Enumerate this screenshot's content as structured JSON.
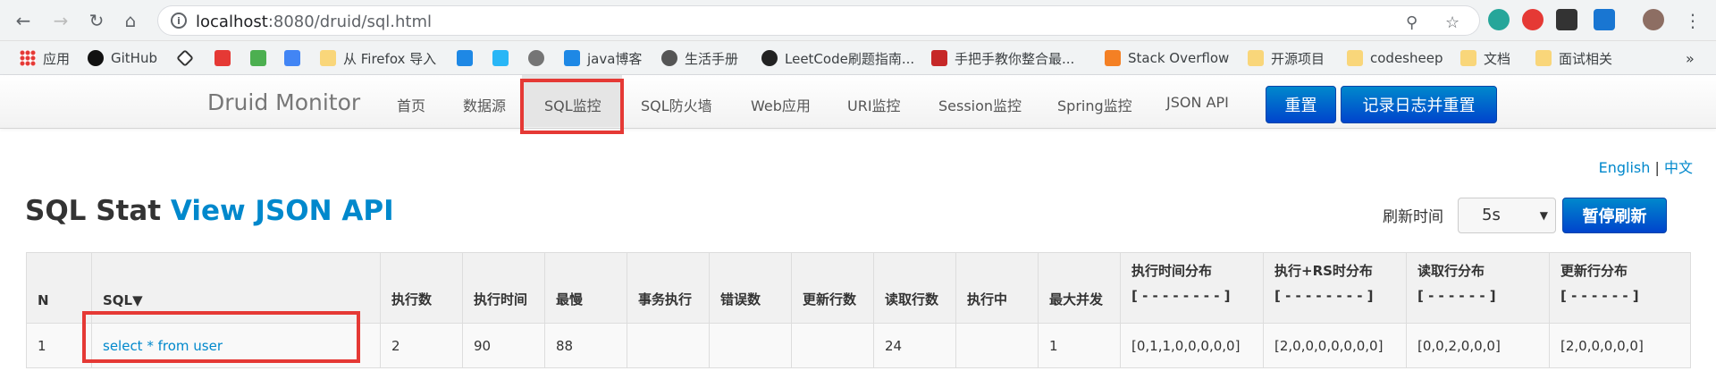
{
  "browser": {
    "url_host": "localhost",
    "url_path": ":8080/druid/sql.html",
    "bookmarks": [
      {
        "label": "应用",
        "icon": "apps-grid-icon"
      },
      {
        "label": "GitHub",
        "icon": "github-icon"
      },
      {
        "label": "",
        "icon": "diamond-icon"
      },
      {
        "label": "",
        "icon": "youtube-icon"
      },
      {
        "label": "",
        "icon": "maps-icon"
      },
      {
        "label": "",
        "icon": "translate-icon"
      },
      {
        "label": "从 Firefox 导入",
        "icon": "folder-icon"
      },
      {
        "label": "",
        "icon": "zhihu-icon"
      },
      {
        "label": "",
        "icon": "bilibili-icon"
      },
      {
        "label": "",
        "icon": "globe-icon"
      },
      {
        "label": "java博客",
        "icon": "zhihu-icon"
      },
      {
        "label": "生活手册",
        "icon": "cookie-icon"
      },
      {
        "label": "LeetCode刷题指南...",
        "icon": "leetcode-icon"
      },
      {
        "label": "手把手教你整合最...",
        "icon": "csdn-icon"
      },
      {
        "label": "Stack Overflow",
        "icon": "stackoverflow-icon"
      },
      {
        "label": "开源项目",
        "icon": "folder-icon"
      },
      {
        "label": "codesheep",
        "icon": "folder-icon"
      },
      {
        "label": "文档",
        "icon": "folder-icon"
      },
      {
        "label": "面试相关",
        "icon": "folder-icon"
      }
    ]
  },
  "navbar": {
    "brand": "Druid Monitor",
    "items": [
      "首页",
      "数据源",
      "SQL监控",
      "SQL防火墙",
      "Web应用",
      "URI监控",
      "Session监控",
      "Spring监控",
      "JSON API"
    ],
    "reset_label": "重置",
    "log_reset_label": "记录日志并重置"
  },
  "lang": {
    "english": "English",
    "sep": "|",
    "chinese": "中文"
  },
  "title": {
    "prefix": "SQL Stat ",
    "link": "View JSON API"
  },
  "refresh": {
    "label": "刷新时间",
    "value": "5s",
    "pause_label": "暂停刷新"
  },
  "table": {
    "headers": [
      "N",
      "SQL▼",
      "执行数",
      "执行时间",
      "最慢",
      "事务执行",
      "错误数",
      "更新行数",
      "读取行数",
      "执行中",
      "最大并发"
    ],
    "dist_headers": [
      {
        "title": "执行时间分布",
        "sub": "[ - - - - - - - - ]"
      },
      {
        "title": "执行+RS时分布",
        "sub": "[ - - - - - - - - ]"
      },
      {
        "title": "读取行分布",
        "sub": "[ - - - - - - ]"
      },
      {
        "title": "更新行分布",
        "sub": "[ - - - - - - ]"
      }
    ],
    "rows": [
      {
        "n": "1",
        "sql": "select * from user",
        "exec_count": "2",
        "exec_time": "90",
        "slowest": "88",
        "tx_exec": "",
        "errors": "",
        "updated_rows": "",
        "read_rows": "24",
        "running": "",
        "max_concurrent": "1",
        "exec_dist": "[0,1,1,0,0,0,0,0]",
        "exec_rs_dist": "[2,0,0,0,0,0,0,0]",
        "read_dist": "[0,0,2,0,0,0]",
        "update_dist": "[2,0,0,0,0,0]"
      }
    ]
  }
}
